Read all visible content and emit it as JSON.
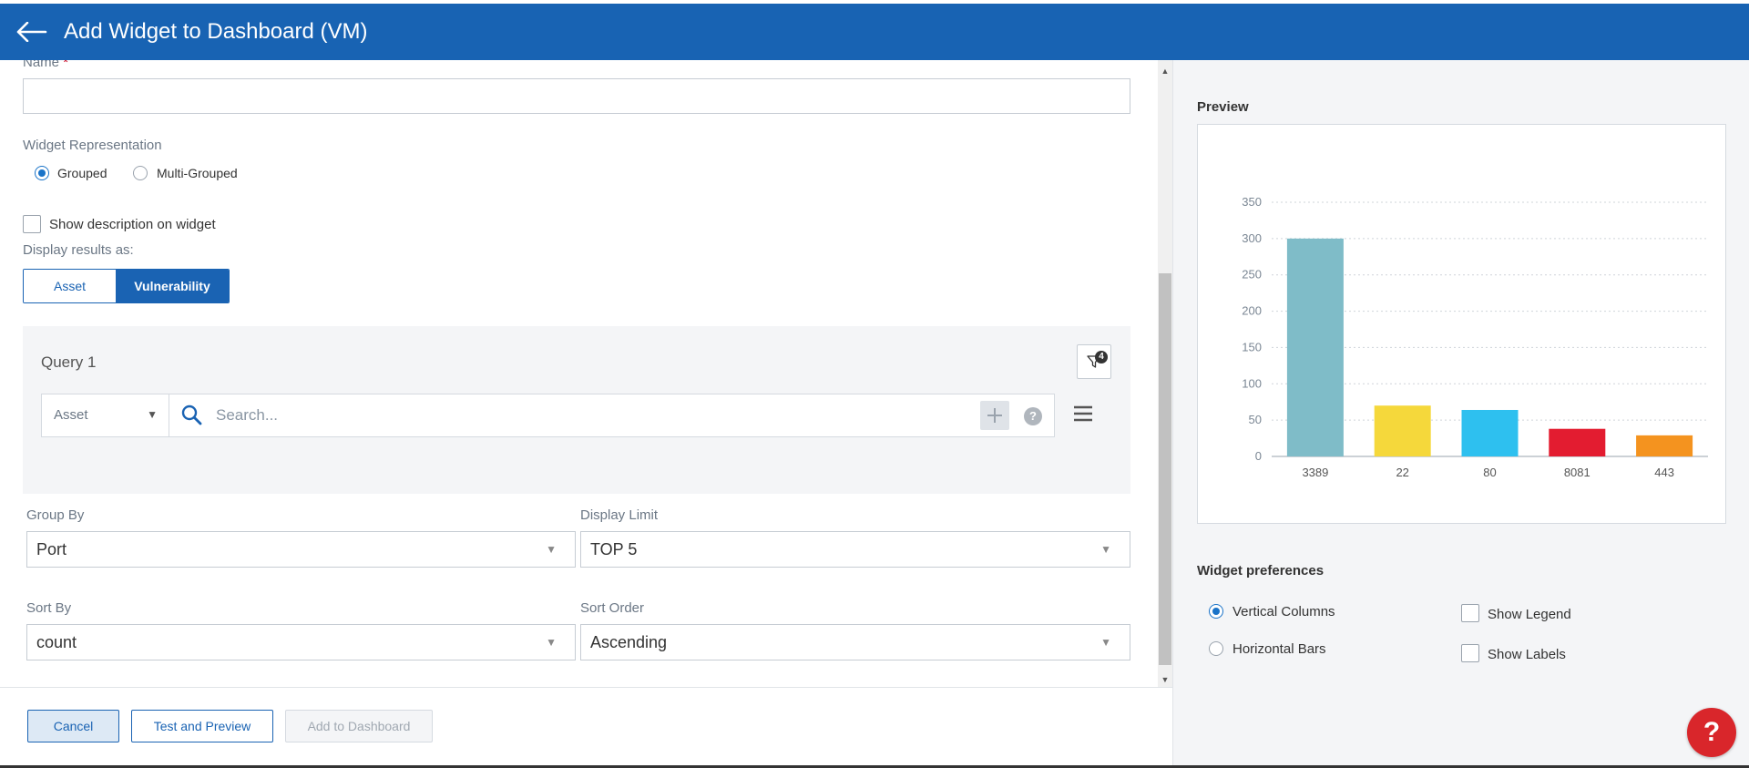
{
  "header": {
    "title": "Add Widget to Dashboard (VM)"
  },
  "form": {
    "name_label": "Name",
    "name_required": "*",
    "name_value": "",
    "representation_label": "Widget Representation",
    "representation_options": [
      "Grouped",
      "Multi-Grouped"
    ],
    "representation_selected": "Grouped",
    "show_description_label": "Show description on widget",
    "display_results_label": "Display results as:",
    "display_results_options": [
      "Asset",
      "Vulnerability"
    ],
    "display_results_selected": "Vulnerability",
    "query": {
      "title": "Query 1",
      "filter_count": "4",
      "type_select": "Asset",
      "search_placeholder": "Search..."
    },
    "group_by": {
      "label": "Group By",
      "value": "Port"
    },
    "display_limit": {
      "label": "Display Limit",
      "value": "TOP 5"
    },
    "sort_by": {
      "label": "Sort By",
      "value": "count"
    },
    "sort_order": {
      "label": "Sort Order",
      "value": "Ascending"
    }
  },
  "footer": {
    "cancel_label": "Cancel",
    "test_label": "Test and Preview",
    "add_label": "Add to Dashboard"
  },
  "preview": {
    "title": "Preview"
  },
  "preferences": {
    "title": "Widget preferences",
    "vertical_label": "Vertical Columns",
    "horizontal_label": "Horizontal Bars",
    "legend_label": "Show Legend",
    "labels_label": "Show Labels",
    "orientation_selected": "Vertical Columns"
  },
  "help_fab": "?",
  "colors": {
    "header": "#1863b3",
    "accent": "#1a63b3",
    "help": "#d9262b"
  },
  "chart_data": {
    "type": "bar",
    "categories": [
      "3389",
      "22",
      "80",
      "8081",
      "443"
    ],
    "values": [
      300,
      70,
      64,
      38,
      29
    ],
    "colors": [
      "#7fbcc8",
      "#f5d83b",
      "#2ec0ef",
      "#e31c30",
      "#f4931f"
    ],
    "yticks": [
      0,
      50,
      100,
      150,
      200,
      250,
      300,
      350
    ],
    "ylim": [
      0,
      350
    ],
    "grid": true,
    "title": "",
    "xlabel": "",
    "ylabel": ""
  }
}
